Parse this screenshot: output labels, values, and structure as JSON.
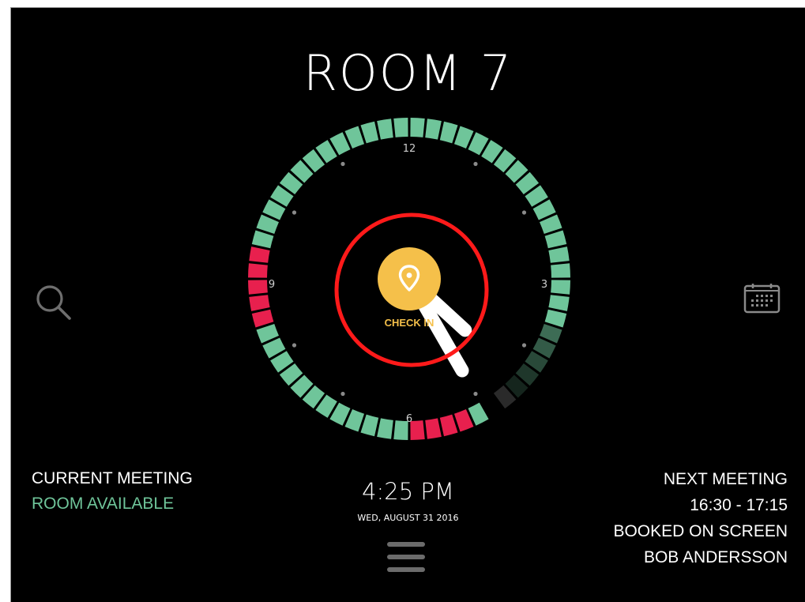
{
  "room": {
    "title": "ROOM 7"
  },
  "clock": {
    "labels": {
      "top": "12",
      "right": "3",
      "bottom": "6",
      "left": "9"
    },
    "current_time": {
      "hour": 16,
      "minute": 25
    },
    "check_in": {
      "label": "CHECK IN",
      "icon": "location-pin-icon"
    },
    "segment_minutes": 5,
    "ring_status_by_segment": [
      "available",
      "available",
      "available",
      "available",
      "available",
      "available",
      "available",
      "available",
      "available",
      "available",
      "available",
      "available",
      "available",
      "available",
      "available",
      "available",
      "available",
      "available",
      "fading",
      "fading",
      "fading",
      "fading",
      "fading",
      "current",
      "gap",
      "available",
      "booked",
      "booked",
      "booked",
      "booked",
      "available",
      "available",
      "available",
      "available",
      "available",
      "available",
      "available",
      "available",
      "available",
      "available",
      "available",
      "available",
      "booked",
      "booked",
      "booked",
      "booked",
      "booked",
      "available",
      "available",
      "available",
      "available",
      "available",
      "available",
      "available",
      "available",
      "available",
      "available",
      "available",
      "available",
      "available"
    ],
    "colors": {
      "available": "#6fc59a",
      "booked": "#e8204e",
      "check_in_button": "#f5c04a",
      "check_in_label": "#f5c04a",
      "hands": "#ffffff",
      "annotation_circle": "#ff1a1a",
      "tick_dots": "#8a8a8a",
      "numerals": "#cfcfcf"
    }
  },
  "current_meeting": {
    "heading": "CURRENT MEETING",
    "status": "ROOM AVAILABLE"
  },
  "time_display": {
    "time": "4:25 PM",
    "date": "WED, AUGUST 31 2016"
  },
  "next_meeting": {
    "heading": "NEXT MEETING",
    "time_range": "16:30 - 17:15",
    "title": "BOOKED ON SCREEN",
    "organizer": "BOB ANDERSSON"
  },
  "icons": {
    "search": "search-icon",
    "calendar": "calendar-icon",
    "menu": "hamburger-menu-icon"
  }
}
